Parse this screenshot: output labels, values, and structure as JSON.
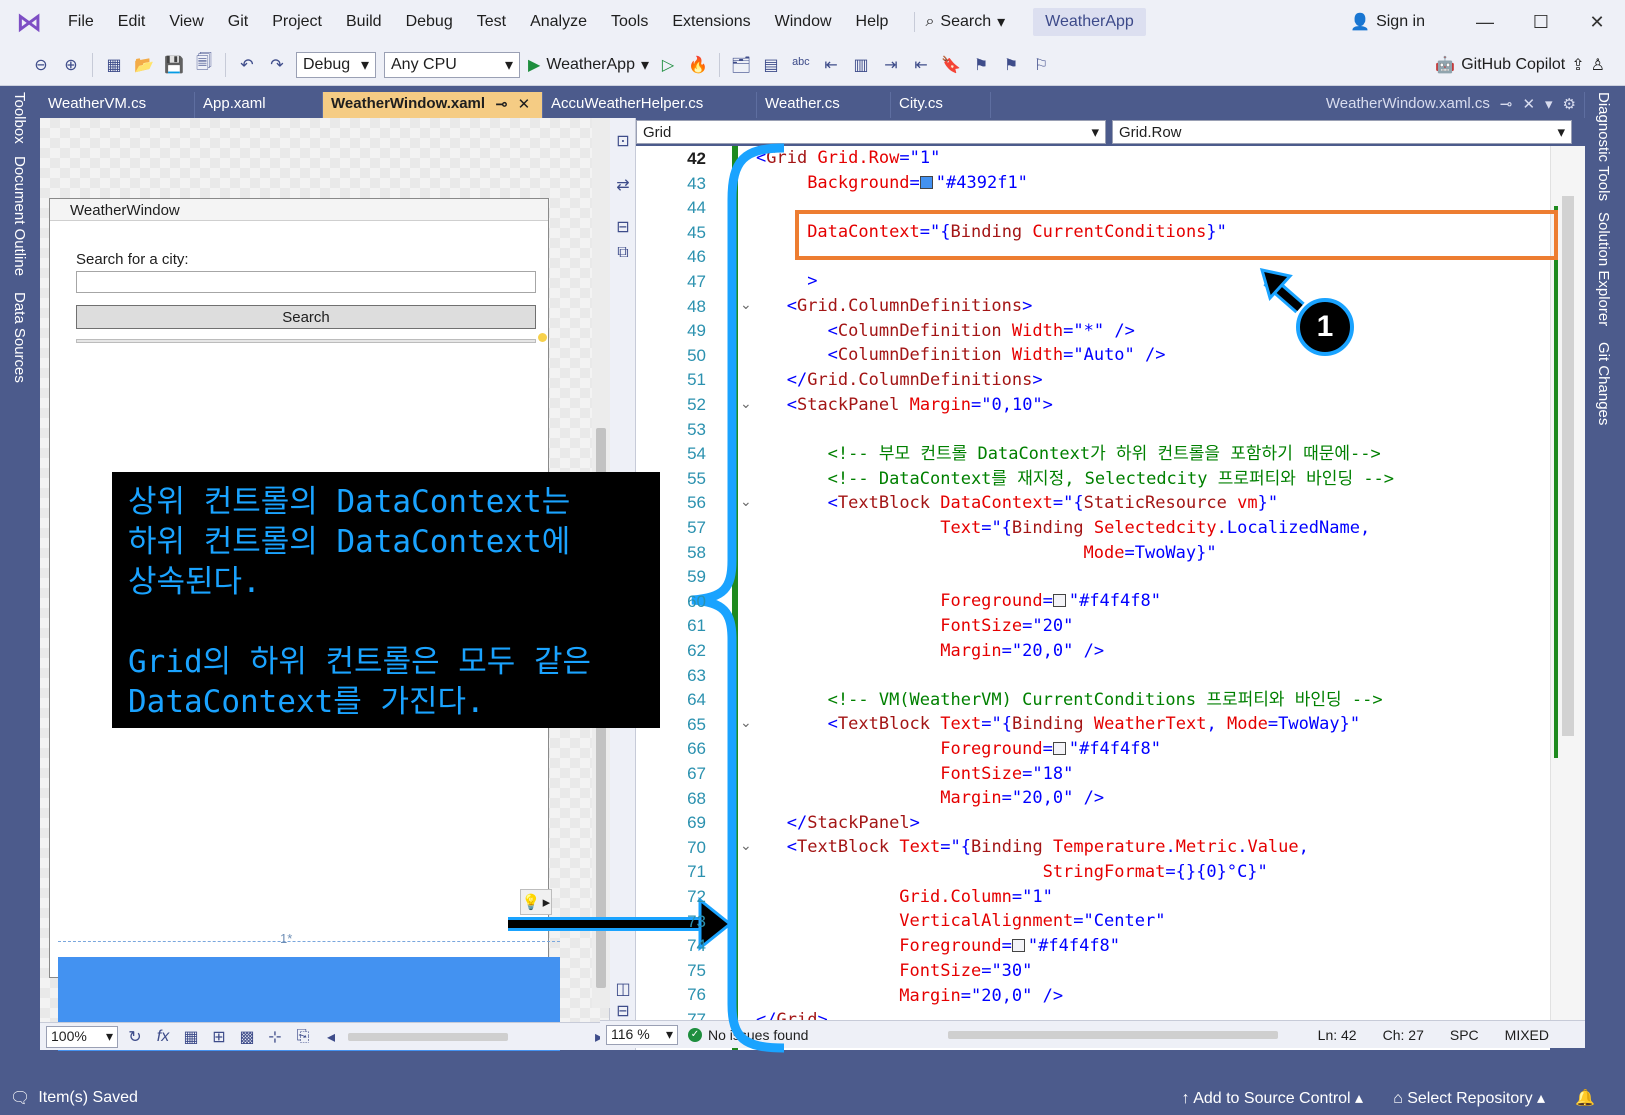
{
  "menu": {
    "items": [
      "File",
      "Edit",
      "View",
      "Git",
      "Project",
      "Build",
      "Debug",
      "Test",
      "Analyze",
      "Tools",
      "Extensions",
      "Window",
      "Help"
    ],
    "search": "Search",
    "app_name": "WeatherApp",
    "sign_in": "Sign in"
  },
  "toolbar": {
    "configuration": "Debug",
    "platform": "Any CPU",
    "run_target": "WeatherApp",
    "copilot": "GitHub Copilot"
  },
  "left_strip": {
    "tabs": [
      "Toolbox",
      "Document Outline",
      "Data Sources"
    ]
  },
  "right_strip": {
    "tabs": [
      "Diagnostic Tools",
      "Solution Explorer",
      "Git Changes"
    ]
  },
  "tabs": {
    "items": [
      "WeatherVM.cs",
      "App.xaml",
      "WeatherWindow.xaml",
      "AccuWeatherHelper.cs",
      "Weather.cs",
      "City.cs"
    ],
    "active_index": 2,
    "preview": "WeatherWindow.xaml.cs"
  },
  "designer": {
    "window_title": "WeatherWindow",
    "search_label": "Search for a city:",
    "search_button": "Search",
    "row_marker": "1*",
    "zoom": "100%",
    "fx": "fx",
    "grid_color": "#4392f1"
  },
  "editor": {
    "nav_left": "Grid",
    "nav_right": "Grid.Row",
    "line_numbers": [
      "42",
      "43",
      "44",
      "45",
      "46",
      "47",
      "48",
      "49",
      "50",
      "51",
      "52",
      "53",
      "54",
      "55",
      "56",
      "57",
      "58",
      "59",
      "60",
      "61",
      "62",
      "63",
      "64",
      "65",
      "66",
      "67",
      "68",
      "69",
      "70",
      "71",
      "72",
      "73",
      "74",
      "75",
      "76",
      "77"
    ],
    "current_line": "42",
    "comments": {
      "c54": "<!-- 부모 컨트롤 DataContext가 하위 컨트롤을 포함하기 때문에-->",
      "c55": "<!-- DataContext를 재지정, Selectedcity 프로퍼티와 바인딩 -->",
      "c64": "<!-- VM(WeatherVM) CurrentConditions 프로퍼티와 바인딩 -->"
    }
  },
  "editor_status": {
    "zoom": "116 %",
    "issues": "No issues found",
    "line": "Ln: 42",
    "col": "Ch: 27",
    "spc": "SPC",
    "eol": "MIXED"
  },
  "statusbar": {
    "saved": "Item(s) Saved",
    "source_control": "Add to Source Control",
    "repository": "Select Repository"
  },
  "annotation": {
    "lines": [
      "상위 컨트롤의 DataContext는",
      "하위 컨트롤의 DataContext에",
      "상속된다.",
      "",
      "Grid의 하위 컨트롤은 모두 같은",
      "DataContext를 가진다."
    ],
    "badge": "1",
    "colors": {
      "text": "#1aa3ff",
      "box": "#ed7d31",
      "brace": "#1aa3ff"
    }
  }
}
